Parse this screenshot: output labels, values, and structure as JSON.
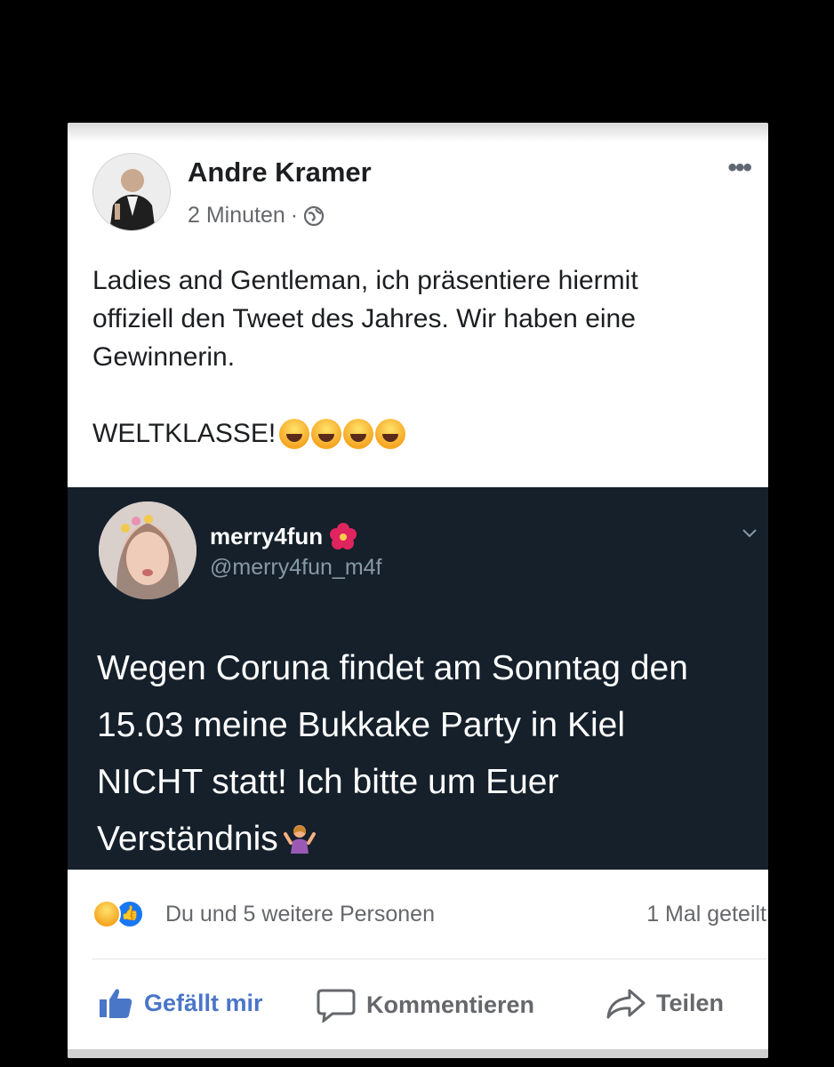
{
  "post": {
    "author": "Andre Kramer",
    "time": "2 Minuten",
    "separator": "·",
    "audience_icon": "globe-icon",
    "more_icon": "•••",
    "text_lines": [
      "Ladies and Gentleman, ich präsentiere hiermit",
      "offiziell den Tweet des Jahres. Wir haben eine",
      "Gewinnerin."
    ],
    "exclaim": "WELTKLASSE!",
    "exclaim_emojis": [
      "laughing-emoji",
      "rofl-emoji",
      "laughing-emoji",
      "rofl-emoji"
    ]
  },
  "tweet": {
    "name": "merry4fun",
    "name_emoji": "hibiscus-icon",
    "handle": "@merry4fun_m4f",
    "lines": [
      "Wegen Coruna findet am Sonntag den",
      "15.03 meine Bukkake Party in Kiel",
      "NICHT statt! Ich bitte um Euer",
      "Verständnis"
    ],
    "trailing_emoji": "shrug-icon",
    "background": "#15202b"
  },
  "reactions": {
    "icons": [
      "haha-icon",
      "like-icon"
    ],
    "text": "Du und 5 weitere Personen",
    "shares": "1 Mal geteilt"
  },
  "actions": {
    "like": "Gefällt mir",
    "comment": "Kommentieren",
    "share": "Teilen"
  },
  "colors": {
    "like_active": "#4a76c8",
    "secondary_text": "#65676b",
    "tweet_handle": "#8899a6"
  }
}
